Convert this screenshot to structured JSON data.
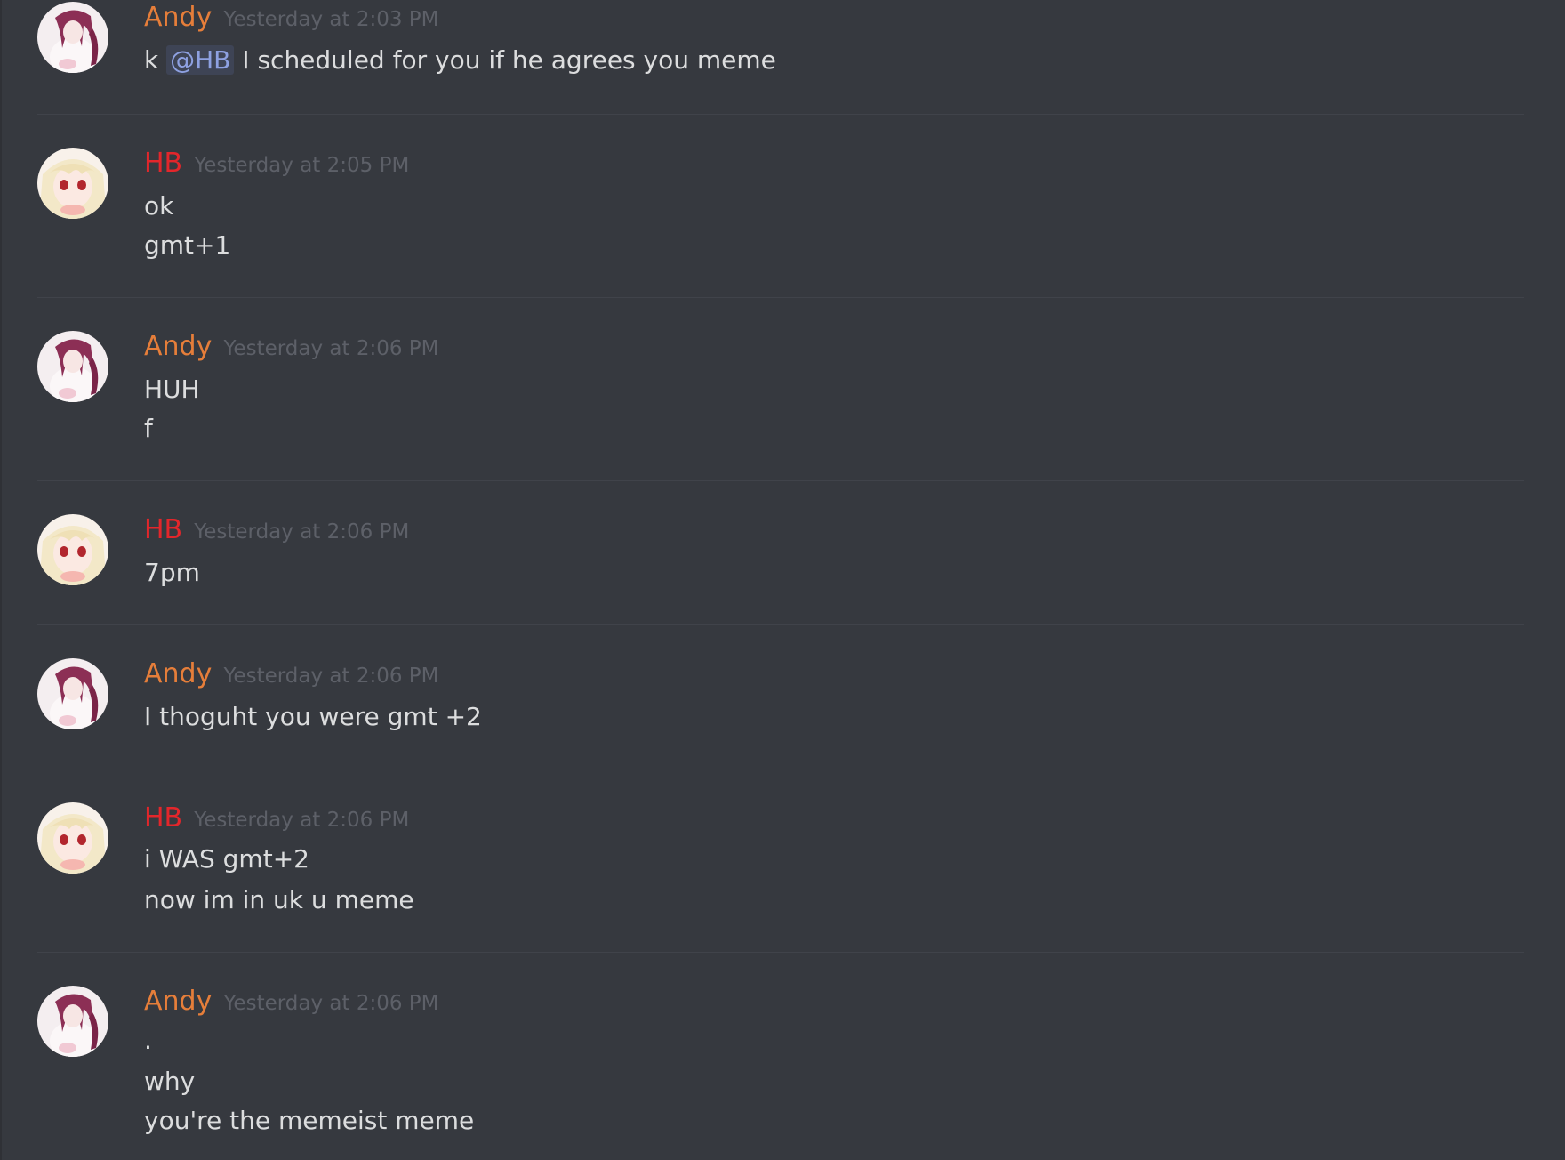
{
  "colors": {
    "background": "#36393f",
    "andy_name": "#e67e3a",
    "hb_name": "#e3262b",
    "timestamp": "#5d6068",
    "message_text": "#dcddde",
    "mention": "#8ea1e1"
  },
  "messages": [
    {
      "author": "Andy",
      "timestamp": "Yesterday at 2:03 PM",
      "line1_prefix": "k",
      "mention": "@HB",
      "line1_suffix": "I scheduled for you if he agrees you meme"
    },
    {
      "author": "HB",
      "timestamp": "Yesterday at 2:05 PM",
      "lines": [
        "ok",
        "gmt+1"
      ]
    },
    {
      "author": "Andy",
      "timestamp": "Yesterday at 2:06 PM",
      "lines": [
        "HUH",
        "f"
      ]
    },
    {
      "author": "HB",
      "timestamp": "Yesterday at 2:06 PM",
      "lines": [
        "7pm"
      ]
    },
    {
      "author": "Andy",
      "timestamp": "Yesterday at 2:06 PM",
      "lines": [
        "I thoguht you were gmt +2"
      ]
    },
    {
      "author": "HB",
      "timestamp": "Yesterday at 2:06 PM",
      "lines": [
        "i WAS gmt+2",
        "now im in uk u meme"
      ]
    },
    {
      "author": "Andy",
      "timestamp": "Yesterday at 2:06 PM",
      "lines": [
        ".",
        "why",
        "you're the memeist meme"
      ]
    }
  ]
}
